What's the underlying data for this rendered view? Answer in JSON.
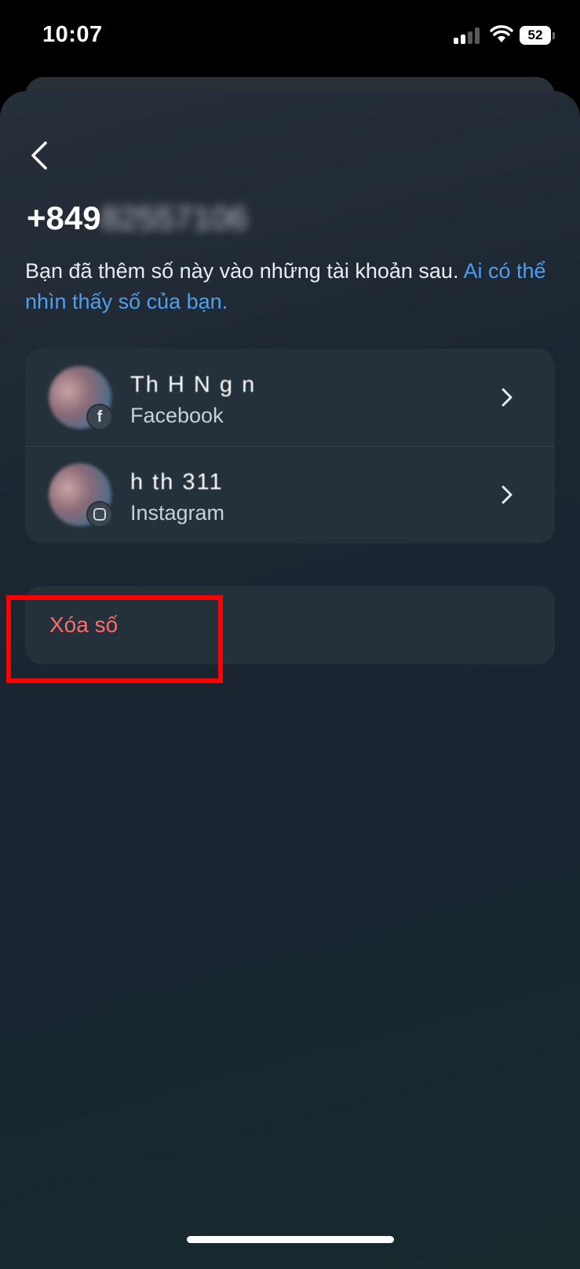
{
  "status_bar": {
    "time": "10:07",
    "battery": "52"
  },
  "header": {
    "phone_prefix": "+849",
    "phone_hidden": "82557106"
  },
  "description": {
    "text": "Bạn đã thêm số này vào những tài khoản sau. ",
    "link": "Ai có thể nhìn thấy số của bạn."
  },
  "accounts": [
    {
      "name": "Th  H  N g  n",
      "platform": "Facebook",
      "icon": "facebook-icon"
    },
    {
      "name": "h       th  311",
      "platform": "Instagram",
      "icon": "instagram-icon"
    }
  ],
  "delete_action": {
    "label": "Xóa số",
    "color": "#ff6b6b"
  },
  "colors": {
    "link": "#4e9ff0",
    "highlight": "#ff0000",
    "card": "#24303a"
  }
}
